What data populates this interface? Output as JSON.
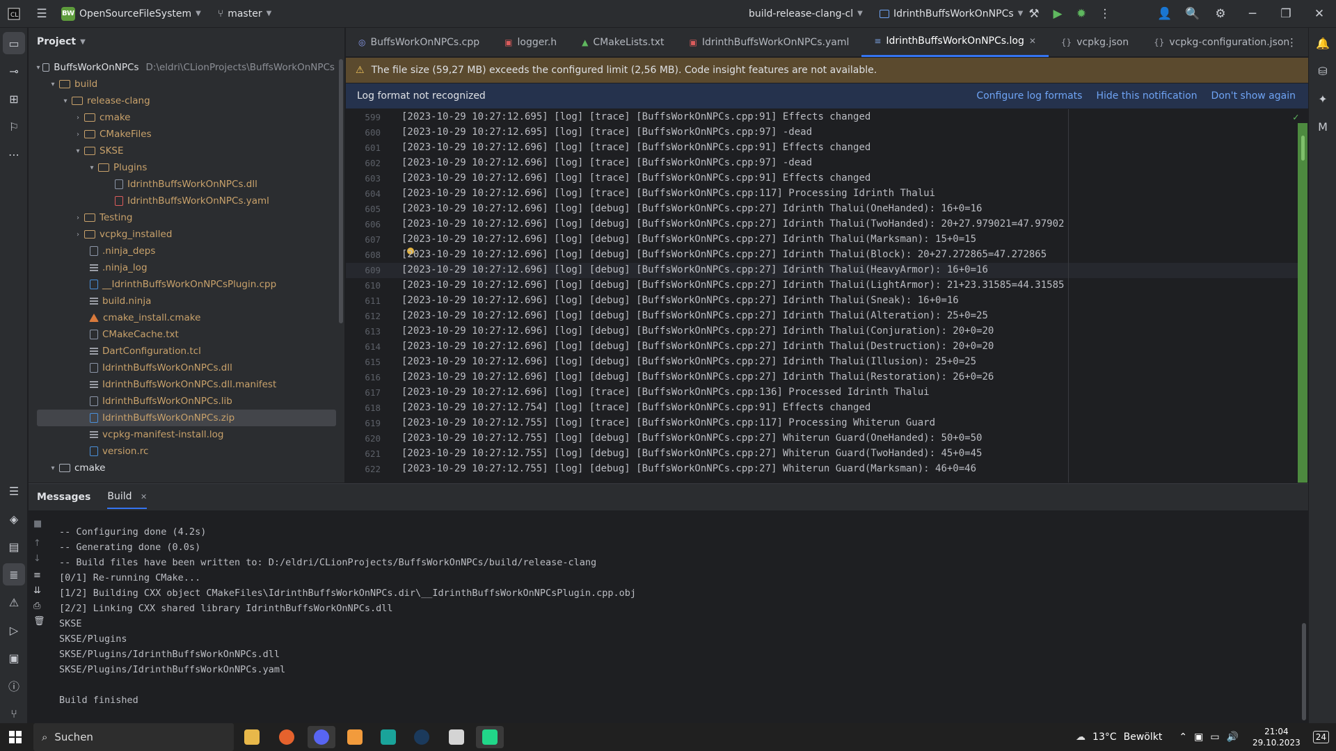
{
  "titlebar": {
    "project_badge": "BW",
    "project_name": "OpenSourceFileSystem",
    "branch": "master",
    "run_config": "build-release-clang-cl",
    "target": "IdrinthBuffsWorkOnNPCs"
  },
  "project_panel": {
    "title": "Project",
    "root_name": "BuffsWorkOnNPCs",
    "root_path": "D:\\eldri\\CLionProjects\\BuffsWorkOnNPCs",
    "items": [
      {
        "label": "build"
      },
      {
        "label": "release-clang"
      },
      {
        "label": "cmake"
      },
      {
        "label": "CMakeFiles"
      },
      {
        "label": "SKSE"
      },
      {
        "label": "Plugins"
      },
      {
        "label": "IdrinthBuffsWorkOnNPCs.dll"
      },
      {
        "label": "IdrinthBuffsWorkOnNPCs.yaml"
      },
      {
        "label": "Testing"
      },
      {
        "label": "vcpkg_installed"
      },
      {
        "label": ".ninja_deps"
      },
      {
        "label": ".ninja_log"
      },
      {
        "label": "__IdrinthBuffsWorkOnNPCsPlugin.cpp"
      },
      {
        "label": "build.ninja"
      },
      {
        "label": "cmake_install.cmake"
      },
      {
        "label": "CMakeCache.txt"
      },
      {
        "label": "DartConfiguration.tcl"
      },
      {
        "label": "IdrinthBuffsWorkOnNPCs.dll"
      },
      {
        "label": "IdrinthBuffsWorkOnNPCs.dll.manifest"
      },
      {
        "label": "IdrinthBuffsWorkOnNPCs.lib"
      },
      {
        "label": "IdrinthBuffsWorkOnNPCs.zip"
      },
      {
        "label": "vcpkg-manifest-install.log"
      },
      {
        "label": "version.rc"
      },
      {
        "label": "cmake"
      }
    ]
  },
  "tabs": [
    {
      "label": "BuffsWorkOnNPCs.cpp",
      "icon": "cpp-file-icon"
    },
    {
      "label": "logger.h",
      "icon": "header-file-icon"
    },
    {
      "label": "CMakeLists.txt",
      "icon": "cmake-icon"
    },
    {
      "label": "IdrinthBuffsWorkOnNPCs.yaml",
      "icon": "yaml-file-icon"
    },
    {
      "label": "IdrinthBuffsWorkOnNPCs.log",
      "icon": "log-file-icon",
      "active": true
    },
    {
      "label": "vcpkg.json",
      "icon": "json-file-icon"
    },
    {
      "label": "vcpkg-configuration.json",
      "icon": "json-file-icon"
    }
  ],
  "warning_banner": "The file size (59,27 MB) exceeds the configured limit (2,56 MB). Code insight features are not available.",
  "notice": {
    "text": "Log format not recognized",
    "configure": "Configure log formats",
    "hide": "Hide this notification",
    "dont_show": "Don't show again"
  },
  "editor": {
    "lines": [
      {
        "num": "599",
        "text": "[2023-10-29 10:27:12.695] [log] [trace] [BuffsWorkOnNPCs.cpp:91] Effects changed"
      },
      {
        "num": "600",
        "text": "[2023-10-29 10:27:12.695] [log] [trace] [BuffsWorkOnNPCs.cpp:97] -dead"
      },
      {
        "num": "601",
        "text": "[2023-10-29 10:27:12.696] [log] [trace] [BuffsWorkOnNPCs.cpp:91] Effects changed"
      },
      {
        "num": "602",
        "text": "[2023-10-29 10:27:12.696] [log] [trace] [BuffsWorkOnNPCs.cpp:97] -dead"
      },
      {
        "num": "603",
        "text": "[2023-10-29 10:27:12.696] [log] [trace] [BuffsWorkOnNPCs.cpp:91] Effects changed"
      },
      {
        "num": "604",
        "text": "[2023-10-29 10:27:12.696] [log] [trace] [BuffsWorkOnNPCs.cpp:117] Processing Idrinth Thalui"
      },
      {
        "num": "605",
        "text": "[2023-10-29 10:27:12.696] [log] [debug] [BuffsWorkOnNPCs.cpp:27] Idrinth Thalui(OneHanded): 16+0=16"
      },
      {
        "num": "606",
        "text": "[2023-10-29 10:27:12.696] [log] [debug] [BuffsWorkOnNPCs.cpp:27] Idrinth Thalui(TwoHanded): 20+27.979021=47.97902"
      },
      {
        "num": "607",
        "text": "[2023-10-29 10:27:12.696] [log] [debug] [BuffsWorkOnNPCs.cpp:27] Idrinth Thalui(Marksman): 15+0=15"
      },
      {
        "num": "608",
        "text": "[2023-10-29 10:27:12.696] [log] [debug] [BuffsWorkOnNPCs.cpp:27] Idrinth Thalui(Block): 20+27.272865=47.272865"
      },
      {
        "num": "609",
        "text": "[2023-10-29 10:27:12.696] [log] [debug] [BuffsWorkOnNPCs.cpp:27] Idrinth Thalui(HeavyArmor): 16+0=16"
      },
      {
        "num": "610",
        "text": "[2023-10-29 10:27:12.696] [log] [debug] [BuffsWorkOnNPCs.cpp:27] Idrinth Thalui(LightArmor): 21+23.31585=44.31585"
      },
      {
        "num": "611",
        "text": "[2023-10-29 10:27:12.696] [log] [debug] [BuffsWorkOnNPCs.cpp:27] Idrinth Thalui(Sneak): 16+0=16"
      },
      {
        "num": "612",
        "text": "[2023-10-29 10:27:12.696] [log] [debug] [BuffsWorkOnNPCs.cpp:27] Idrinth Thalui(Alteration): 25+0=25"
      },
      {
        "num": "613",
        "text": "[2023-10-29 10:27:12.696] [log] [debug] [BuffsWorkOnNPCs.cpp:27] Idrinth Thalui(Conjuration): 20+0=20"
      },
      {
        "num": "614",
        "text": "[2023-10-29 10:27:12.696] [log] [debug] [BuffsWorkOnNPCs.cpp:27] Idrinth Thalui(Destruction): 20+0=20"
      },
      {
        "num": "615",
        "text": "[2023-10-29 10:27:12.696] [log] [debug] [BuffsWorkOnNPCs.cpp:27] Idrinth Thalui(Illusion): 25+0=25"
      },
      {
        "num": "616",
        "text": "[2023-10-29 10:27:12.696] [log] [debug] [BuffsWorkOnNPCs.cpp:27] Idrinth Thalui(Restoration): 26+0=26"
      },
      {
        "num": "617",
        "text": "[2023-10-29 10:27:12.696] [log] [trace] [BuffsWorkOnNPCs.cpp:136] Processed Idrinth Thalui"
      },
      {
        "num": "618",
        "text": "[2023-10-29 10:27:12.754] [log] [trace] [BuffsWorkOnNPCs.cpp:91] Effects changed"
      },
      {
        "num": "619",
        "text": "[2023-10-29 10:27:12.755] [log] [trace] [BuffsWorkOnNPCs.cpp:117] Processing Whiterun Guard"
      },
      {
        "num": "620",
        "text": "[2023-10-29 10:27:12.755] [log] [debug] [BuffsWorkOnNPCs.cpp:27] Whiterun Guard(OneHanded): 50+0=50"
      },
      {
        "num": "621",
        "text": "[2023-10-29 10:27:12.755] [log] [debug] [BuffsWorkOnNPCs.cpp:27] Whiterun Guard(TwoHanded): 45+0=45"
      },
      {
        "num": "622",
        "text": "[2023-10-29 10:27:12.755] [log] [debug] [BuffsWorkOnNPCs.cpp:27] Whiterun Guard(Marksman): 46+0=46"
      }
    ]
  },
  "bottom_panel": {
    "tab_messages": "Messages",
    "tab_build": "Build",
    "output": [
      "-- Configuring done (4.2s)",
      "-- Generating done (0.0s)",
      "-- Build files have been written to: D:/eldri/CLionProjects/BuffsWorkOnNPCs/build/release-clang",
      "[0/1] Re-running CMake...",
      "[1/2] Building CXX object CMakeFiles\\IdrinthBuffsWorkOnNPCs.dir\\__IdrinthBuffsWorkOnNPCsPlugin.cpp.obj",
      "[2/2] Linking CXX shared library IdrinthBuffsWorkOnNPCs.dll",
      "SKSE",
      "SKSE/Plugins",
      "SKSE/Plugins/IdrinthBuffsWorkOnNPCs.dll",
      "SKSE/Plugins/IdrinthBuffsWorkOnNPCs.yaml",
      "",
      "Build finished"
    ]
  },
  "taskbar": {
    "search_placeholder": "Suchen",
    "weather_temp": "13°C",
    "weather_text": "Bewölkt",
    "time": "21:04",
    "date": "29.10.2023",
    "notif_count": "24"
  },
  "colors": {
    "accent": "#3574f0",
    "warning_bg": "#5b4a2e",
    "notice_bg": "#25324d",
    "link": "#6fa4f5"
  }
}
